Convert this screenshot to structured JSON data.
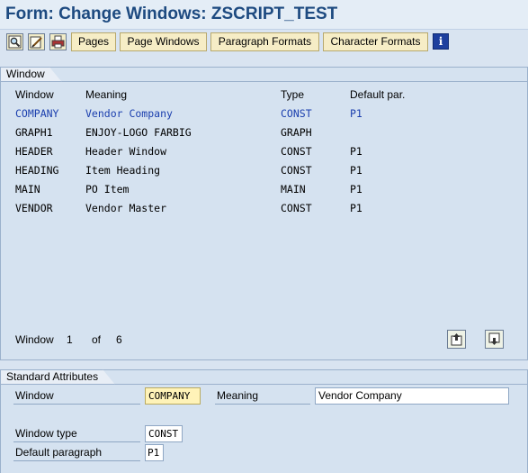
{
  "title": "Form: Change Windows: ZSCRIPT_TEST",
  "toolbar": {
    "icons": [
      "display-icon",
      "change-icon",
      "print-icon"
    ],
    "buttons": {
      "pages": "Pages",
      "page_windows": "Page Windows",
      "paragraph_formats": "Paragraph Formats",
      "character_formats": "Character Formats"
    },
    "info_glyph": "i"
  },
  "window_group": {
    "title": "Window",
    "headers": {
      "window": "Window",
      "meaning": "Meaning",
      "type": "Type",
      "default_par": "Default par."
    },
    "rows": [
      {
        "window": "COMPANY",
        "meaning": "Vendor Company",
        "type": "CONST",
        "default_par": "P1"
      },
      {
        "window": "GRAPH1",
        "meaning": "ENJOY-LOGO FARBIG",
        "type": "GRAPH",
        "default_par": ""
      },
      {
        "window": "HEADER",
        "meaning": "Header Window",
        "type": "CONST",
        "default_par": "P1"
      },
      {
        "window": "HEADING",
        "meaning": "Item Heading",
        "type": "CONST",
        "default_par": "P1"
      },
      {
        "window": "MAIN",
        "meaning": "PO Item",
        "type": "MAIN",
        "default_par": "P1"
      },
      {
        "window": "VENDOR",
        "meaning": "Vendor Master",
        "type": "CONST",
        "default_par": "P1"
      }
    ],
    "selected_row": 0,
    "pager": {
      "label": "Window",
      "current": "1",
      "of_label": "of",
      "total": "6"
    }
  },
  "attributes": {
    "title": "Standard Attributes",
    "window_label": "Window",
    "window_value": "COMPANY",
    "meaning_label": "Meaning",
    "meaning_value": "Vendor Company",
    "window_type_label": "Window type",
    "window_type_value": "CONST",
    "default_paragraph_label": "Default paragraph",
    "default_paragraph_value": "P1"
  },
  "colors": {
    "title_text": "#1d4a80",
    "background": "#d9e4f1",
    "selected_row_text": "#1b3fae",
    "button_fill": "#f6edc6",
    "info_blue": "#1d3f9e"
  }
}
